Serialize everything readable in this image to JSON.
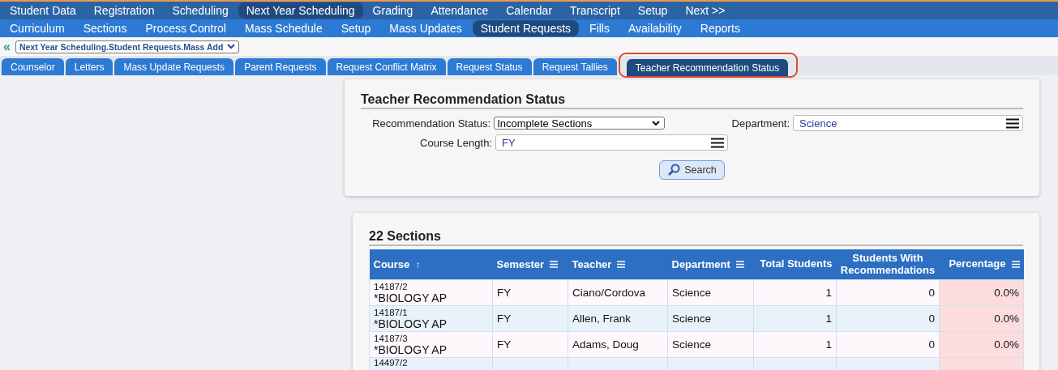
{
  "main_menu": [
    {
      "label": "Student Data",
      "selected": false
    },
    {
      "label": "Registration",
      "selected": false
    },
    {
      "label": "Scheduling",
      "selected": false
    },
    {
      "label": "Next Year Scheduling",
      "selected": true
    },
    {
      "label": "Grading",
      "selected": false
    },
    {
      "label": "Attendance",
      "selected": false
    },
    {
      "label": "Calendar",
      "selected": false
    },
    {
      "label": "Transcript",
      "selected": false
    },
    {
      "label": "Setup",
      "selected": false
    },
    {
      "label": "Next >>",
      "selected": false
    }
  ],
  "sub_menu": [
    {
      "label": "Curriculum",
      "selected": false
    },
    {
      "label": "Sections",
      "selected": false
    },
    {
      "label": "Process Control",
      "selected": false
    },
    {
      "label": "Mass Schedule",
      "selected": false
    },
    {
      "label": "Setup",
      "selected": false
    },
    {
      "label": "Mass Updates",
      "selected": false
    },
    {
      "label": "Student Requests",
      "selected": true
    },
    {
      "label": "Fills",
      "selected": false
    },
    {
      "label": "Availability",
      "selected": false
    },
    {
      "label": "Reports",
      "selected": false
    }
  ],
  "breadcrumb": {
    "back": "«",
    "path": "Next Year Scheduling.Student Requests.Mass Add"
  },
  "tabs": [
    {
      "label": "Counselor",
      "selected": false,
      "highlighted": false
    },
    {
      "label": "Letters",
      "selected": false,
      "highlighted": false
    },
    {
      "label": "Mass Update Requests",
      "selected": false,
      "highlighted": false
    },
    {
      "label": "Parent Requests",
      "selected": false,
      "highlighted": false
    },
    {
      "label": "Request Conflict Matrix",
      "selected": false,
      "highlighted": false
    },
    {
      "label": "Request Status",
      "selected": false,
      "highlighted": false
    },
    {
      "label": "Request Tallies",
      "selected": false,
      "highlighted": false
    },
    {
      "label": "Teacher Recommendation Status",
      "selected": true,
      "highlighted": true
    }
  ],
  "filter_panel": {
    "title": "Teacher Recommendation Status",
    "recommendation_status": {
      "label": "Recommendation Status:",
      "value": "Incomplete Sections"
    },
    "department": {
      "label": "Department:",
      "value": "Science"
    },
    "course_length": {
      "label": "Course Length:",
      "value": "FY"
    },
    "search_button": "Search"
  },
  "results": {
    "title": "22 Sections",
    "columns": [
      {
        "label": "Course",
        "sorted": true,
        "menu": false
      },
      {
        "label": "Semester",
        "sorted": false,
        "menu": true
      },
      {
        "label": "Teacher",
        "sorted": false,
        "menu": true
      },
      {
        "label": "Department",
        "sorted": false,
        "menu": true
      },
      {
        "label": "Total Students",
        "sorted": false,
        "menu": false
      },
      {
        "label": "Students With Recommendations",
        "sorted": false,
        "menu": false
      },
      {
        "label": "Percentage",
        "sorted": false,
        "menu": true
      }
    ],
    "sort_glyph": "↑",
    "rows": [
      {
        "code": "14187/2",
        "course": "*BIOLOGY AP",
        "semester": "FY",
        "teacher": "Ciano/Cordova",
        "department": "Science",
        "total": "1",
        "with_recs": "0",
        "percentage": "0.0%"
      },
      {
        "code": "14187/1",
        "course": "*BIOLOGY AP",
        "semester": "FY",
        "teacher": "Allen, Frank",
        "department": "Science",
        "total": "1",
        "with_recs": "0",
        "percentage": "0.0%"
      },
      {
        "code": "14187/3",
        "course": "*BIOLOGY AP",
        "semester": "FY",
        "teacher": "Adams, Doug",
        "department": "Science",
        "total": "1",
        "with_recs": "0",
        "percentage": "0.0%"
      },
      {
        "code": "14497/2"
      }
    ]
  }
}
